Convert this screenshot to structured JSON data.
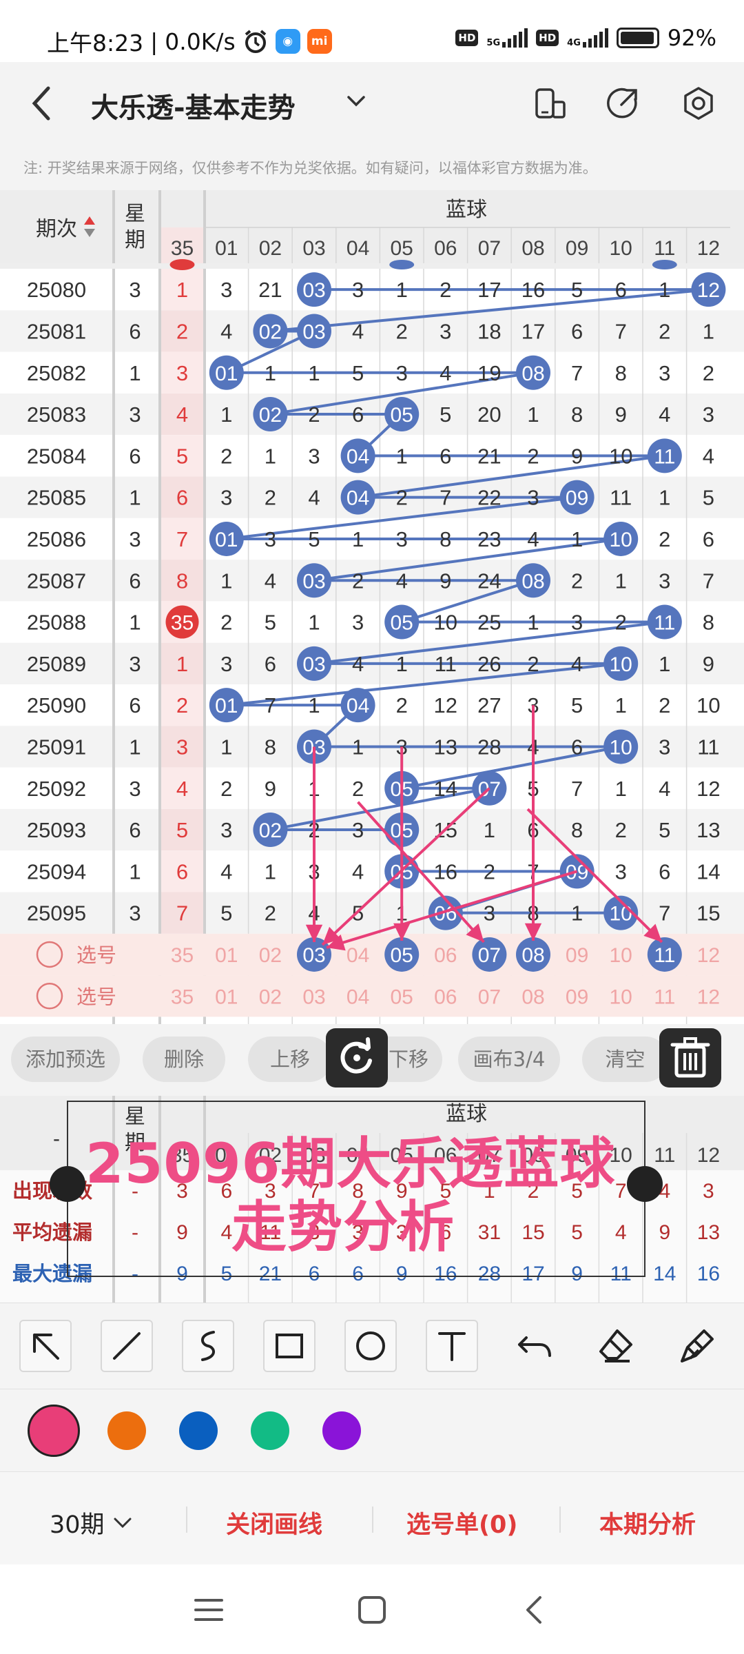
{
  "status_bar": {
    "time": "上午8:23",
    "speed": "0.0K/s",
    "net1": "5G",
    "net2": "4G",
    "battery": "92%",
    "hd": "HD"
  },
  "title_bar": {
    "title": "大乐透-基本走势"
  },
  "notice": "注: 开奖结果来源于网络，仅供参考不作为兑奖依据。如有疑问，以福体彩官方数据为准。",
  "table": {
    "header_period": "期次",
    "header_week": "星期",
    "header_blue": "蓝球",
    "sub_35": "35",
    "columns": [
      "01",
      "02",
      "03",
      "04",
      "05",
      "06",
      "07",
      "08",
      "09",
      "10",
      "11",
      "12"
    ],
    "rows": [
      {
        "period": "25080",
        "week": "3",
        "c35": "1",
        "cells": [
          "3",
          "21",
          "03",
          "3",
          "1",
          "2",
          "17",
          "16",
          "5",
          "6",
          "1",
          "12"
        ],
        "hits": [
          2,
          11
        ]
      },
      {
        "period": "25081",
        "week": "6",
        "c35": "2",
        "cells": [
          "4",
          "02",
          "03",
          "4",
          "2",
          "3",
          "18",
          "17",
          "6",
          "7",
          "2",
          "1"
        ],
        "hits": [
          1,
          2
        ]
      },
      {
        "period": "25082",
        "week": "1",
        "c35": "3",
        "cells": [
          "01",
          "1",
          "1",
          "5",
          "3",
          "4",
          "19",
          "08",
          "7",
          "8",
          "3",
          "2"
        ],
        "hits": [
          0,
          7
        ]
      },
      {
        "period": "25083",
        "week": "3",
        "c35": "4",
        "cells": [
          "1",
          "02",
          "2",
          "6",
          "05",
          "5",
          "20",
          "1",
          "8",
          "9",
          "4",
          "3"
        ],
        "hits": [
          1,
          4
        ]
      },
      {
        "period": "25084",
        "week": "6",
        "c35": "5",
        "cells": [
          "2",
          "1",
          "3",
          "04",
          "1",
          "6",
          "21",
          "2",
          "9",
          "10",
          "11",
          "4"
        ],
        "hits": [
          3,
          10
        ]
      },
      {
        "period": "25085",
        "week": "1",
        "c35": "6",
        "cells": [
          "3",
          "2",
          "4",
          "04",
          "2",
          "7",
          "22",
          "3",
          "09",
          "11",
          "1",
          "5"
        ],
        "hits": [
          3,
          8
        ]
      },
      {
        "period": "25086",
        "week": "3",
        "c35": "7",
        "cells": [
          "01",
          "3",
          "5",
          "1",
          "3",
          "8",
          "23",
          "4",
          "1",
          "10",
          "2",
          "6"
        ],
        "hits": [
          0,
          9
        ]
      },
      {
        "period": "25087",
        "week": "6",
        "c35": "8",
        "cells": [
          "1",
          "4",
          "03",
          "2",
          "4",
          "9",
          "24",
          "08",
          "2",
          "1",
          "3",
          "7"
        ],
        "hits": [
          2,
          7
        ]
      },
      {
        "period": "25088",
        "week": "1",
        "c35": "35",
        "cells": [
          "2",
          "5",
          "1",
          "3",
          "05",
          "10",
          "25",
          "1",
          "3",
          "2",
          "11",
          "8"
        ],
        "hits": [
          4,
          10
        ]
      },
      {
        "period": "25089",
        "week": "3",
        "c35": "1",
        "cells": [
          "3",
          "6",
          "03",
          "4",
          "1",
          "11",
          "26",
          "2",
          "4",
          "10",
          "1",
          "9"
        ],
        "hits": [
          2,
          9
        ]
      },
      {
        "period": "25090",
        "week": "6",
        "c35": "2",
        "cells": [
          "01",
          "7",
          "1",
          "04",
          "2",
          "12",
          "27",
          "3",
          "5",
          "1",
          "2",
          "10"
        ],
        "hits": [
          0,
          3
        ]
      },
      {
        "period": "25091",
        "week": "1",
        "c35": "3",
        "cells": [
          "1",
          "8",
          "03",
          "1",
          "3",
          "13",
          "28",
          "4",
          "6",
          "10",
          "3",
          "11"
        ],
        "hits": [
          2,
          9
        ]
      },
      {
        "period": "25092",
        "week": "3",
        "c35": "4",
        "cells": [
          "2",
          "9",
          "1",
          "2",
          "05",
          "14",
          "07",
          "5",
          "7",
          "1",
          "4",
          "12"
        ],
        "hits": [
          4,
          6
        ]
      },
      {
        "period": "25093",
        "week": "6",
        "c35": "5",
        "cells": [
          "3",
          "02",
          "2",
          "3",
          "05",
          "15",
          "1",
          "6",
          "8",
          "2",
          "5",
          "13"
        ],
        "hits": [
          1,
          4
        ]
      },
      {
        "period": "25094",
        "week": "1",
        "c35": "6",
        "cells": [
          "4",
          "1",
          "3",
          "4",
          "05",
          "16",
          "2",
          "7",
          "09",
          "3",
          "6",
          "14"
        ],
        "hits": [
          4,
          8
        ]
      },
      {
        "period": "25095",
        "week": "3",
        "c35": "7",
        "cells": [
          "5",
          "2",
          "4",
          "5",
          "1",
          "06",
          "3",
          "8",
          "1",
          "10",
          "7",
          "15"
        ],
        "hits": [
          5,
          9
        ]
      }
    ],
    "pick_rows": [
      {
        "label": "选号",
        "c35": "35",
        "cells": [
          "01",
          "02",
          "03",
          "04",
          "05",
          "06",
          "07",
          "08",
          "09",
          "10",
          "11",
          "12"
        ],
        "hits": [
          2,
          4,
          6,
          7,
          10
        ]
      },
      {
        "label": "选号",
        "c35": "35",
        "cells": [
          "01",
          "02",
          "03",
          "04",
          "05",
          "06",
          "07",
          "08",
          "09",
          "10",
          "11",
          "12"
        ],
        "hits": []
      }
    ]
  },
  "toolbar": {
    "add_preselect": "添加预选",
    "delete": "删除",
    "move_up": "上移",
    "move_down": "下移",
    "canvas": "画布3/4",
    "clear": "清空"
  },
  "stats": {
    "header_week": "星期",
    "header_blue": "蓝球",
    "dash": "-",
    "sub_35": "35",
    "rows": [
      {
        "label": "出现次数",
        "c35": "-",
        "values": [
          "3",
          "6",
          "3",
          "7",
          "8",
          "9",
          "5",
          "1",
          "2",
          "5",
          "7",
          "4",
          "3"
        ],
        "color": "#b32d2d"
      },
      {
        "label": "平均遗漏",
        "c35": "-",
        "values": [
          "9",
          "4",
          "11",
          "3",
          "3",
          "3",
          "6",
          "31",
          "15",
          "5",
          "4",
          "9",
          "13"
        ],
        "color": "#b32d2d"
      },
      {
        "label": "最大遗漏",
        "c35": "-",
        "values": [
          "9",
          "5",
          "21",
          "6",
          "6",
          "9",
          "16",
          "28",
          "17",
          "9",
          "11",
          "14",
          "16"
        ],
        "color": "#2d62b3"
      }
    ]
  },
  "overlay": {
    "line1": "25096期大乐透蓝球",
    "line2": "走势分析"
  },
  "palette": {
    "colors": [
      "#e83e78",
      "#ec6e0e",
      "#0a5fbf",
      "#12bb85",
      "#8a14d8"
    ],
    "selected": 0
  },
  "bottom_bar": {
    "periods": "30期",
    "close_lines": "关闭画线",
    "pick_list": "选号单(0)",
    "analysis": "本期分析"
  },
  "colors": {
    "ball_blue": "#5575bd",
    "red": "#e03b3b",
    "pink": "#e83e78"
  }
}
